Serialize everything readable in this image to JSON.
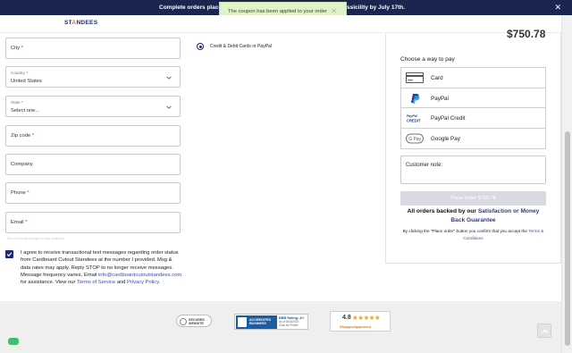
{
  "banner": {
    "text_left": "Complete orders placed",
    "text_right": "ssicility by July 17th.",
    "close": "✕"
  },
  "toast": {
    "message": "The coupon has been applied to your order",
    "close": "✕"
  },
  "brand": {
    "logo_text_a": "ST",
    "logo_text_o": "A",
    "logo_text_b": "NDEES"
  },
  "form": {
    "city": {
      "label": "City",
      "required": "*"
    },
    "country": {
      "label": "Country",
      "required": "*",
      "value": "United States"
    },
    "state": {
      "label": "State",
      "required": "*",
      "value": "Select one..."
    },
    "zip": {
      "label": "Zip code",
      "required": "*"
    },
    "company": {
      "label": "Company"
    },
    "phone": {
      "label": "Phone",
      "required": "*"
    },
    "email": {
      "label": "Email",
      "required": "*"
    },
    "helper_text": "We will email receipt to this address"
  },
  "consent": {
    "checked": true,
    "text_1": "I agree to receive transactional text messages regarding order status from Cardboard Cutout Standees at the number I provided. Msg & data rates may apply. Reply STOP to no longer receive messages. Message frequency varies. Email ",
    "email_link": "info@cardboardcutoutstandees.com",
    "text_2": " for assistance. View our ",
    "tos_link": "Terms of Service",
    "text_3": " and ",
    "privacy_link": "Privacy Policy",
    "text_4": "."
  },
  "payment_method": {
    "option_label": "Credit & Debit Cards or PayPal"
  },
  "summary": {
    "total": "$750.78",
    "choose_label": "Choose a way to pay",
    "pay_options": [
      {
        "label": "Card",
        "icon": "card-icon"
      },
      {
        "label": "PayPal",
        "icon": "paypal-icon"
      },
      {
        "label": "PayPal Credit",
        "icon": "paypal-credit-icon"
      },
      {
        "label": "Google Pay",
        "icon": "google-pay-icon"
      }
    ],
    "customer_note_label": "Customer note:",
    "place_order": "Place order  $750.78",
    "backed_1": "All orders backed by our ",
    "backed_hl": "Satisfaction or Money Back Guarantee",
    "terms_1": "By clicking the \"Place order\" button you confirm that you accept the ",
    "terms_link": "Terms & Conditions"
  },
  "footer": {
    "secure_1": "SECURED",
    "secure_2": "WEBSITE",
    "bbb_seal_1": "ACCREDITED",
    "bbb_seal_2": "BUSINESS",
    "bbb_rating": "BBB Rating: A+",
    "bbb_asof": "As of 8/16/2023",
    "bbb_click": "Click for Profile",
    "sa_score": "4.8",
    "sa_stars": "★★★★★",
    "sa_brand": "ShopperApproved"
  },
  "colors": {
    "navy": "#1a2550",
    "accent": "#3f4f9e",
    "toast_bg": "#dff2c8",
    "chat": "#3ac26b"
  }
}
